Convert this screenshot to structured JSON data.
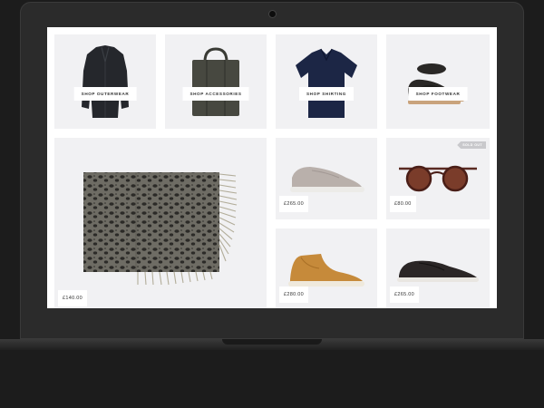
{
  "categories": [
    {
      "label": "SHOP OUTERWEAR",
      "icon": "coat-icon"
    },
    {
      "label": "SHOP ACCESSORIES",
      "icon": "bag-icon"
    },
    {
      "label": "SHOP SHIRTING",
      "icon": "polo-shirt-icon"
    },
    {
      "label": "SHOP FOOTWEAR",
      "icon": "shoes-icon"
    }
  ],
  "products": [
    {
      "name": "leopard-print scarf",
      "price": "£140.00"
    },
    {
      "name": "grey slip-on sneaker",
      "price": "£265.00"
    },
    {
      "name": "tortoiseshell sunglasses",
      "price": "£80.00",
      "badge": "SOLD OUT"
    },
    {
      "name": "tan suede high-top sneaker",
      "price": "£280.00"
    },
    {
      "name": "black leather low-top sneaker",
      "price": "£265.00"
    }
  ],
  "colors": {
    "background": "#1c1c1c",
    "tile": "#f1f1f3",
    "text": "#333333"
  }
}
